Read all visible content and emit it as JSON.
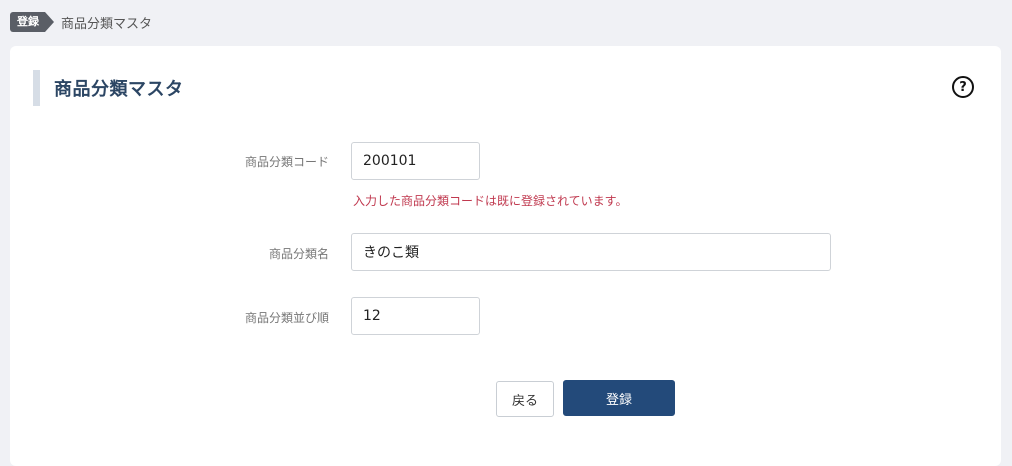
{
  "breadcrumb": {
    "tag": "登録",
    "current": "商品分類マスタ"
  },
  "page": {
    "title": "商品分類マスタ",
    "help_icon": "question-circle-icon"
  },
  "form": {
    "code": {
      "label": "商品分類コード",
      "value": "200101",
      "error": "入力した商品分類コードは既に登録されています。"
    },
    "name": {
      "label": "商品分類名",
      "value": "きのこ類"
    },
    "order": {
      "label": "商品分類並び順",
      "value": "12"
    }
  },
  "actions": {
    "back_label": "戻る",
    "submit_label": "登録"
  },
  "colors": {
    "primary": "#234a7a",
    "error": "#c0394f",
    "title": "#2c4664",
    "background": "#f0f1f5"
  }
}
